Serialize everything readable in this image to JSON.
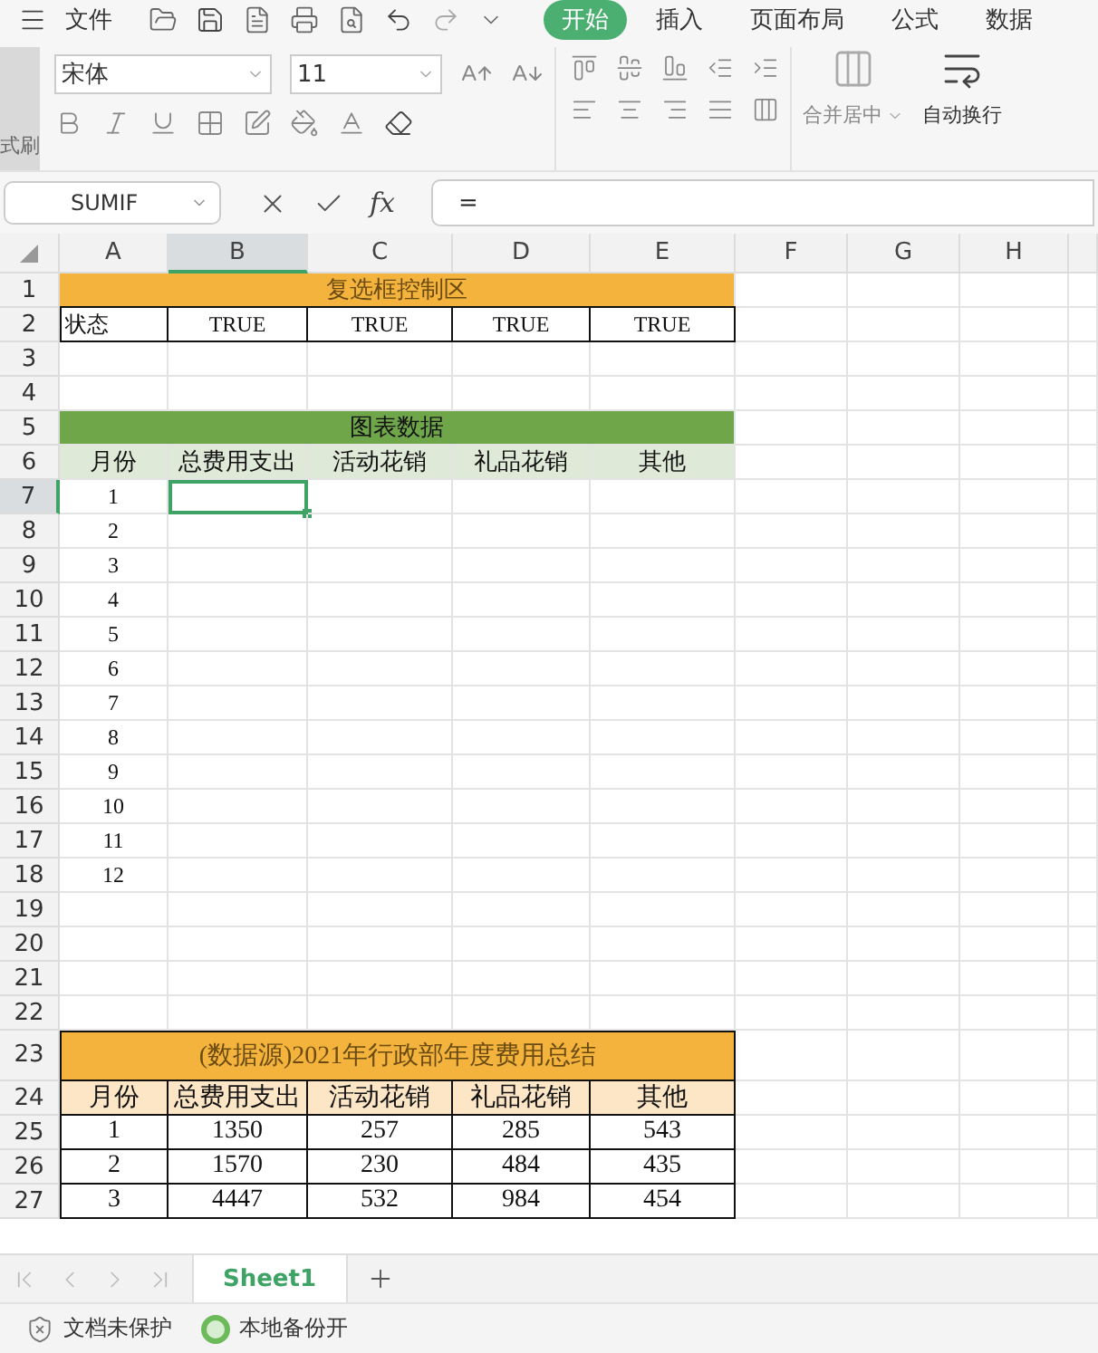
{
  "menu_bar": {
    "file": "文件",
    "tabs": [
      {
        "label": "开始",
        "selected": true
      },
      {
        "label": "插入",
        "selected": false
      },
      {
        "label": "页面布局",
        "selected": false
      },
      {
        "label": "公式",
        "selected": false
      },
      {
        "label": "数据",
        "selected": false
      }
    ]
  },
  "ribbon": {
    "format_painter": "式刷",
    "font": "宋体",
    "size": "11",
    "merge": "合并居中",
    "wrap": "自动换行"
  },
  "formula_bar": {
    "name_box": "SUMIF",
    "fx": "fx",
    "value": "="
  },
  "columns": [
    {
      "label": "A",
      "selected": false
    },
    {
      "label": "B",
      "selected": true
    },
    {
      "label": "C",
      "selected": false
    },
    {
      "label": "D",
      "selected": false
    },
    {
      "label": "E",
      "selected": false
    },
    {
      "label": "F",
      "selected": false
    },
    {
      "label": "G",
      "selected": false
    },
    {
      "label": "H",
      "selected": false
    }
  ],
  "rows": [
    {
      "number": "1",
      "selected": false,
      "kind": "banner",
      "color": "#f3b33d",
      "text": "复选框控制区"
    },
    {
      "number": "2",
      "selected": false,
      "kind": "status",
      "bordered": true,
      "cells": [
        "状态",
        "TRUE",
        "TRUE",
        "TRUE",
        "TRUE"
      ]
    },
    {
      "number": "3",
      "selected": false,
      "kind": "blank"
    },
    {
      "number": "4",
      "selected": false,
      "kind": "blank"
    },
    {
      "number": "5",
      "selected": false,
      "kind": "banner",
      "color": "#6fa64a",
      "text": "图表数据"
    },
    {
      "number": "6",
      "selected": false,
      "kind": "header",
      "bordered": false,
      "color": "#dfe9d7",
      "cells": [
        "月份",
        "总费用支出",
        "活动花销",
        "礼品花销",
        "其他"
      ]
    },
    {
      "number": "7",
      "selected": true,
      "kind": "data",
      "bordered": false,
      "cells": [
        "1"
      ]
    },
    {
      "number": "8",
      "selected": false,
      "kind": "data",
      "bordered": false,
      "cells": [
        "2"
      ]
    },
    {
      "number": "9",
      "selected": false,
      "kind": "data",
      "bordered": false,
      "cells": [
        "3"
      ]
    },
    {
      "number": "10",
      "selected": false,
      "kind": "data",
      "bordered": false,
      "cells": [
        "4"
      ]
    },
    {
      "number": "11",
      "selected": false,
      "kind": "data",
      "bordered": false,
      "cells": [
        "5"
      ]
    },
    {
      "number": "12",
      "selected": false,
      "kind": "data",
      "bordered": false,
      "cells": [
        "6"
      ]
    },
    {
      "number": "13",
      "selected": false,
      "kind": "data",
      "bordered": false,
      "cells": [
        "7"
      ]
    },
    {
      "number": "14",
      "selected": false,
      "kind": "data",
      "bordered": false,
      "cells": [
        "8"
      ]
    },
    {
      "number": "15",
      "selected": false,
      "kind": "data",
      "bordered": false,
      "cells": [
        "9"
      ]
    },
    {
      "number": "16",
      "selected": false,
      "kind": "data",
      "bordered": false,
      "cells": [
        "10"
      ]
    },
    {
      "number": "17",
      "selected": false,
      "kind": "data",
      "bordered": false,
      "cells": [
        "11"
      ]
    },
    {
      "number": "18",
      "selected": false,
      "kind": "data",
      "bordered": false,
      "cells": [
        "12"
      ]
    },
    {
      "number": "19",
      "selected": false,
      "kind": "blank"
    },
    {
      "number": "20",
      "selected": false,
      "kind": "blank"
    },
    {
      "number": "21",
      "selected": false,
      "kind": "blank"
    },
    {
      "number": "22",
      "selected": false,
      "kind": "blank"
    },
    {
      "number": "23",
      "selected": false,
      "kind": "banner",
      "tall": true,
      "color": "#f3b33d",
      "text": "(数据源)2021年行政部年度费用总结"
    },
    {
      "number": "24",
      "selected": false,
      "kind": "header",
      "bordered": true,
      "color": "#fce6c5",
      "cells": [
        "月份",
        "总费用支出",
        "活动花销",
        "礼品花销",
        "其他"
      ]
    },
    {
      "number": "25",
      "selected": false,
      "kind": "data",
      "bordered": true,
      "cells": [
        "1",
        "1350",
        "257",
        "285",
        "543"
      ]
    },
    {
      "number": "26",
      "selected": false,
      "kind": "data",
      "bordered": true,
      "cells": [
        "2",
        "1570",
        "230",
        "484",
        "435"
      ]
    },
    {
      "number": "27",
      "selected": false,
      "kind": "data",
      "bordered": true,
      "cells": [
        "3",
        "4447",
        "532",
        "984",
        "454"
      ]
    }
  ],
  "sheet_tabs": [
    {
      "label": "Sheet1",
      "selected": true
    }
  ],
  "status_bar": [
    "文档未保护",
    "本地备份开"
  ]
}
